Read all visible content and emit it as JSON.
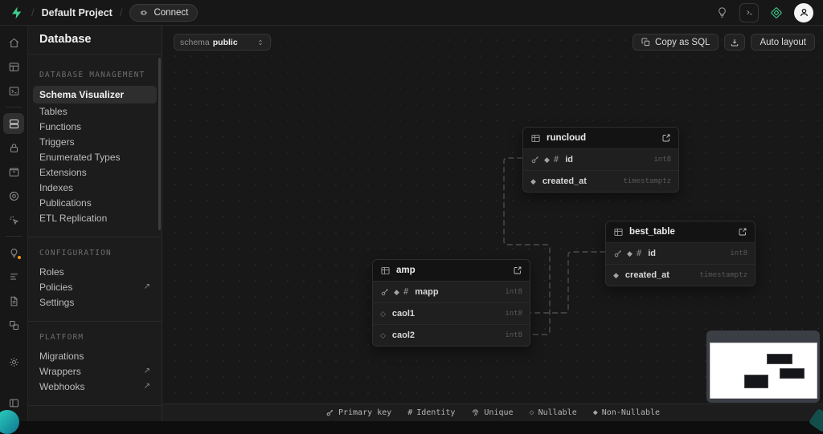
{
  "glyphs": {
    "identity": "#",
    "nullable": "◇",
    "non_nullable": "◆",
    "external": "↗",
    "slash": "/"
  },
  "topbar": {
    "project": "Default Project",
    "connect": "Connect"
  },
  "sidebar": {
    "title": "Database",
    "sections": [
      {
        "heading": "DATABASE MANAGEMENT",
        "items": [
          "Schema Visualizer",
          "Tables",
          "Functions",
          "Triggers",
          "Enumerated Types",
          "Extensions",
          "Indexes",
          "Publications",
          "ETL Replication"
        ]
      },
      {
        "heading": "CONFIGURATION",
        "items": [
          "Roles",
          "Policies",
          "Settings"
        ]
      },
      {
        "heading": "PLATFORM",
        "items": [
          "Migrations",
          "Wrappers",
          "Webhooks"
        ]
      }
    ]
  },
  "toolbar": {
    "schema_label": "schema",
    "schema_value": "public",
    "copy_sql": "Copy as SQL",
    "auto_layout": "Auto layout"
  },
  "canvas": {
    "tables": [
      {
        "name": "runcloud",
        "columns": [
          {
            "name": "id",
            "type": "int8"
          },
          {
            "name": "created_at",
            "type": "timestamptz"
          }
        ]
      },
      {
        "name": "best_table",
        "columns": [
          {
            "name": "id",
            "type": "int8"
          },
          {
            "name": "created_at",
            "type": "timestamptz"
          }
        ]
      },
      {
        "name": "amp",
        "columns": [
          {
            "name": "mapp",
            "type": "int8"
          },
          {
            "name": "caol1",
            "type": "int8"
          },
          {
            "name": "caol2",
            "type": "int8"
          }
        ]
      }
    ]
  },
  "legend": {
    "items": [
      "Primary key",
      "Identity",
      "Unique",
      "Nullable",
      "Non-Nullable"
    ]
  },
  "colors": {
    "brand_green": "#3ecf8e",
    "notification_orange": "#f59e0b"
  }
}
